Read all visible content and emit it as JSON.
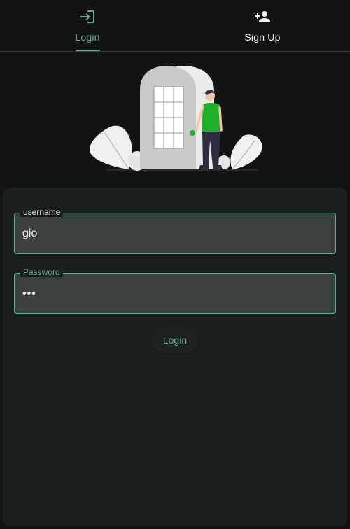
{
  "tabs": [
    {
      "label": "Login",
      "icon": "login-icon",
      "active": true
    },
    {
      "label": "Sign Up",
      "icon": "person-add-icon",
      "active": false
    }
  ],
  "form": {
    "username": {
      "label": "username",
      "value": "gio"
    },
    "password": {
      "label": "Password",
      "value": "•••"
    },
    "submit_label": "Login"
  },
  "colors": {
    "accent": "#6aa886",
    "background": "#121413",
    "card": "#1a1f1d",
    "field": "#39403d",
    "figure_shirt": "#1fb12b"
  }
}
